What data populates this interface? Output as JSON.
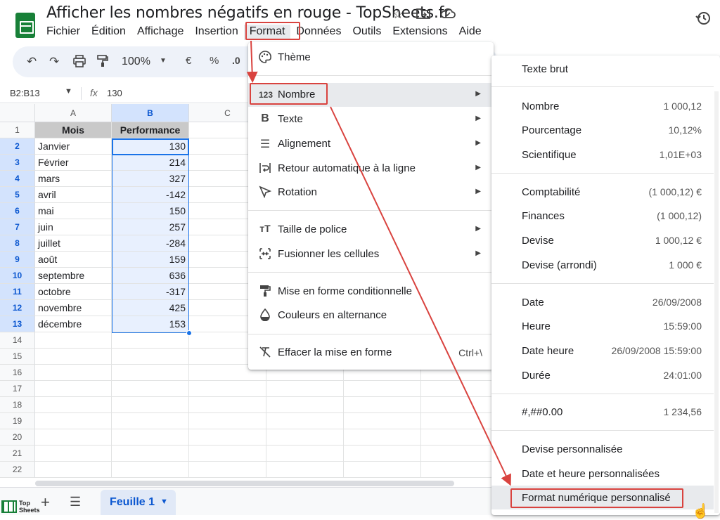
{
  "header": {
    "title": "Afficher les nombres négatifs en rouge - TopSheets.fr",
    "menus": [
      "Fichier",
      "Édition",
      "Affichage",
      "Insertion",
      "Format",
      "Données",
      "Outils",
      "Extensions",
      "Aide"
    ]
  },
  "toolbar": {
    "zoom": "100%",
    "currency": "€",
    "percent": "%",
    "decimal": ".0"
  },
  "formula_bar": {
    "name_box": "B2:B13",
    "fx": "fx",
    "value": "130"
  },
  "grid": {
    "columns": [
      "A",
      "B",
      "C"
    ],
    "row_numbers": [
      "1",
      "2",
      "3",
      "4",
      "5",
      "6",
      "7",
      "8",
      "9",
      "10",
      "11",
      "12",
      "13",
      "14",
      "15",
      "16",
      "17",
      "18",
      "19",
      "20",
      "21",
      "22"
    ],
    "header_row": [
      "Mois",
      "Performance"
    ],
    "rows": [
      [
        "Janvier",
        "130"
      ],
      [
        "Février",
        "214"
      ],
      [
        "mars",
        "327"
      ],
      [
        "avril",
        "-142"
      ],
      [
        "mai",
        "150"
      ],
      [
        "juin",
        "257"
      ],
      [
        "juillet",
        "-284"
      ],
      [
        "août",
        "159"
      ],
      [
        "septembre",
        "636"
      ],
      [
        "octobre",
        "-317"
      ],
      [
        "novembre",
        "425"
      ],
      [
        "décembre",
        "153"
      ]
    ]
  },
  "sheets": {
    "active_tab": "Feuille 1",
    "logo_text": "Top Sheets"
  },
  "format_menu": {
    "items": [
      {
        "icon": "palette-icon",
        "label": "Thème"
      },
      {
        "icon": "number-123-icon",
        "label": "Nombre"
      },
      {
        "icon": "bold-icon",
        "label": "Texte"
      },
      {
        "icon": "align-icon",
        "label": "Alignement"
      },
      {
        "icon": "wrap-icon",
        "label": "Retour automatique à la ligne"
      },
      {
        "icon": "rotation-icon",
        "label": "Rotation"
      },
      {
        "icon": "font-size-icon",
        "label": "Taille de police"
      },
      {
        "icon": "merge-icon",
        "label": "Fusionner les cellules"
      },
      {
        "icon": "paint-roller-icon",
        "label": "Mise en forme conditionnelle"
      },
      {
        "icon": "fill-drop-icon",
        "label": "Couleurs en alternance"
      },
      {
        "icon": "clear-format-icon",
        "label": "Effacer la mise en forme",
        "shortcut": "Ctrl+\\"
      }
    ]
  },
  "number_menu": {
    "items": [
      {
        "label": "Texte brut",
        "example": ""
      },
      {
        "label": "Nombre",
        "example": "1 000,12"
      },
      {
        "label": "Pourcentage",
        "example": "10,12%"
      },
      {
        "label": "Scientifique",
        "example": "1,01E+03"
      },
      {
        "label": "Comptabilité",
        "example": "(1 000,12) €"
      },
      {
        "label": "Finances",
        "example": "(1 000,12)"
      },
      {
        "label": "Devise",
        "example": "1 000,12 €"
      },
      {
        "label": "Devise (arrondi)",
        "example": "1 000 €"
      },
      {
        "label": "Date",
        "example": "26/09/2008"
      },
      {
        "label": "Heure",
        "example": "15:59:00"
      },
      {
        "label": "Date heure",
        "example": "26/09/2008 15:59:00"
      },
      {
        "label": "Durée",
        "example": "24:01:00"
      },
      {
        "label": "#,##0.00",
        "example": "1 234,56"
      },
      {
        "label": "Devise personnalisée",
        "example": ""
      },
      {
        "label": "Date et heure personnalisées",
        "example": ""
      },
      {
        "label": "Format numérique personnalisé",
        "example": ""
      }
    ]
  },
  "colors": {
    "accent": "#1a73e8",
    "annotation_red": "#d9433f",
    "sheets_green": "#188038"
  }
}
